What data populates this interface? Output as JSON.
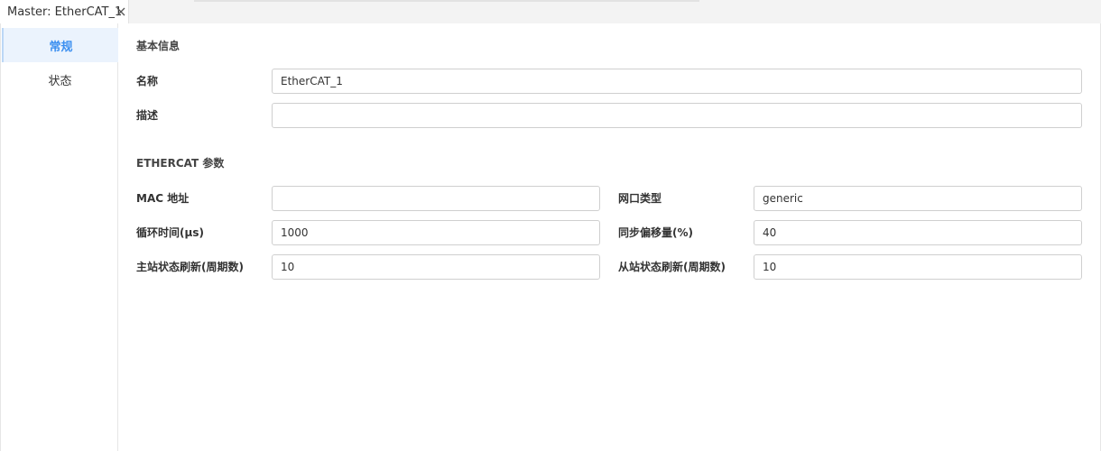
{
  "tab": {
    "title": "Master: EtherCAT_1",
    "close_icon": "close-icon"
  },
  "sidebar": {
    "items": [
      {
        "label": "常规",
        "active": true
      },
      {
        "label": "状态",
        "active": false
      }
    ]
  },
  "basic": {
    "section_title": "基本信息",
    "name_label": "名称",
    "name_value": "EtherCAT_1",
    "desc_label": "描述",
    "desc_value": ""
  },
  "ethercat": {
    "section_title": "ETHERCAT 参数",
    "mac_label": "MAC 地址",
    "mac_value": "",
    "nic_type_label": "网口类型",
    "nic_type_value": "generic",
    "cycle_label": "循环时间(µs)",
    "cycle_value": "1000",
    "sync_offset_label": "同步偏移量(%)",
    "sync_offset_value": "40",
    "master_refresh_label": "主站状态刷新(周期数)",
    "master_refresh_value": "10",
    "slave_refresh_label": "从站状态刷新(周期数)",
    "slave_refresh_value": "10"
  },
  "colors": {
    "accent": "#3b8ff0",
    "active_bg": "#ebf3fd",
    "border": "#cfcfcf"
  }
}
